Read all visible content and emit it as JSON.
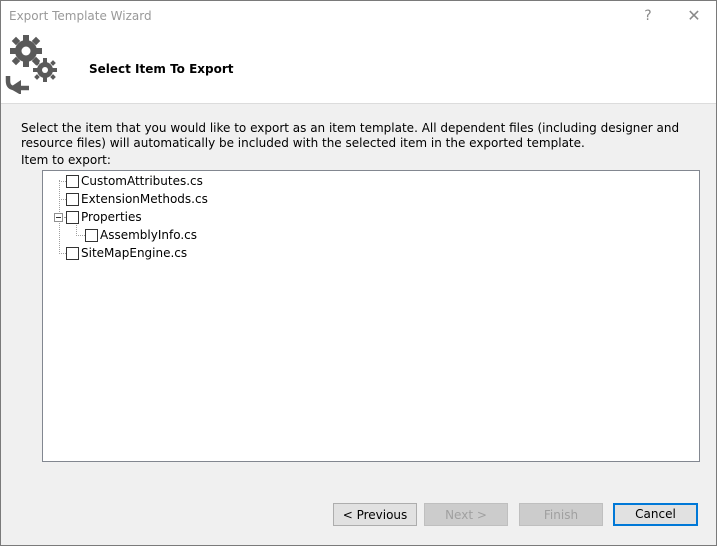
{
  "window": {
    "title": "Export Template Wizard",
    "help_glyph": "?",
    "close_glyph": "✕"
  },
  "header": {
    "title": "Select Item To Export",
    "icon": "gears-export-icon"
  },
  "content": {
    "description": "Select the item that you would like to export as an item template. All dependent files (including designer and resource files) will automatically be included with the selected item in the exported template.",
    "tree_label": "Item to export:"
  },
  "tree": {
    "items": [
      {
        "label": "CustomAttributes.cs",
        "checked": false,
        "level": 0
      },
      {
        "label": "ExtensionMethods.cs",
        "checked": false,
        "level": 0
      },
      {
        "label": "Properties",
        "checked": false,
        "level": 0,
        "expanded": true
      },
      {
        "label": "AssemblyInfo.cs",
        "checked": false,
        "level": 1
      },
      {
        "label": "SiteMapEngine.cs",
        "checked": false,
        "level": 0
      }
    ]
  },
  "buttons": {
    "previous": "< Previous",
    "next": "Next >",
    "finish": "Finish",
    "cancel": "Cancel"
  },
  "colors": {
    "accent": "#0078d7",
    "disabled_text": "#a0a0a0",
    "dialog_bg": "#f0f0f0"
  }
}
